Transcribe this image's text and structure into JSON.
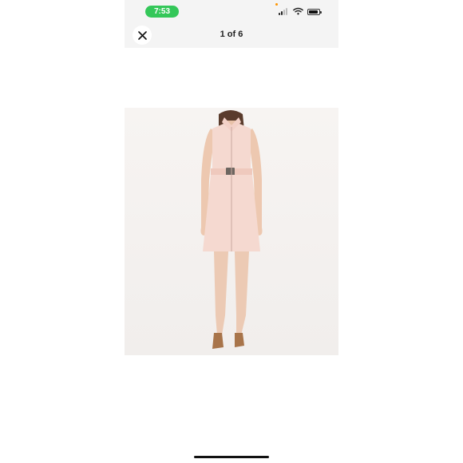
{
  "status_bar": {
    "time": "7:53",
    "icons": [
      "signal-icon",
      "wifi-icon",
      "battery-icon"
    ]
  },
  "header": {
    "close_icon": "close-icon",
    "counter": "1 of 6"
  },
  "gallery": {
    "current_image": 1,
    "total_images": 6
  },
  "colors": {
    "time_pill": "#34c759",
    "background": "#ffffff",
    "header_bg": "#f4f4f4",
    "photo_bg": "#f5f2f0",
    "dress": "#f5d9d0"
  }
}
